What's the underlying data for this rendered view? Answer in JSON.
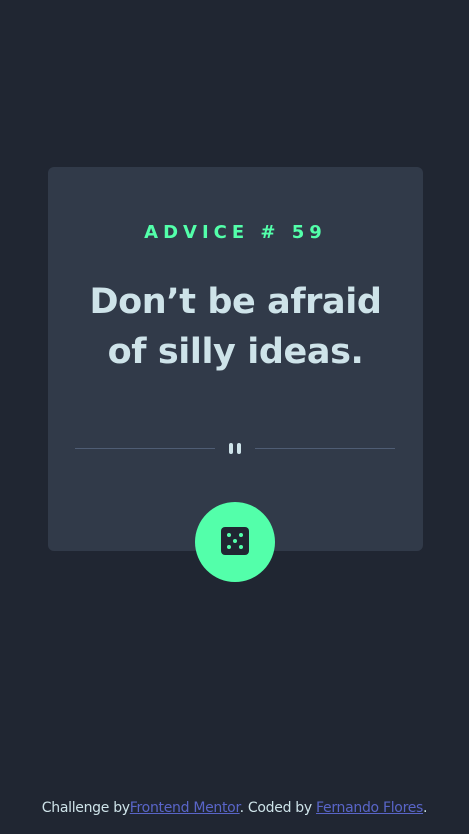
{
  "advice": {
    "label": "ADVICE # 59",
    "quote": "Don’t be afraid of silly ideas."
  },
  "divider": {
    "icon": "pause-icon"
  },
  "dice_button": {
    "icon": "dice-icon"
  },
  "footer": {
    "prefix": "Challenge by",
    "link1": "Frontend Mentor",
    "middle": ". Coded by ",
    "link2": "Fernando Flores",
    "suffix": "."
  },
  "colors": {
    "background": "#202632",
    "card": "#313a49",
    "accent": "#53ffaa",
    "text": "#cee3e9",
    "divider": "#4f5d74",
    "link": "#5965c8"
  }
}
